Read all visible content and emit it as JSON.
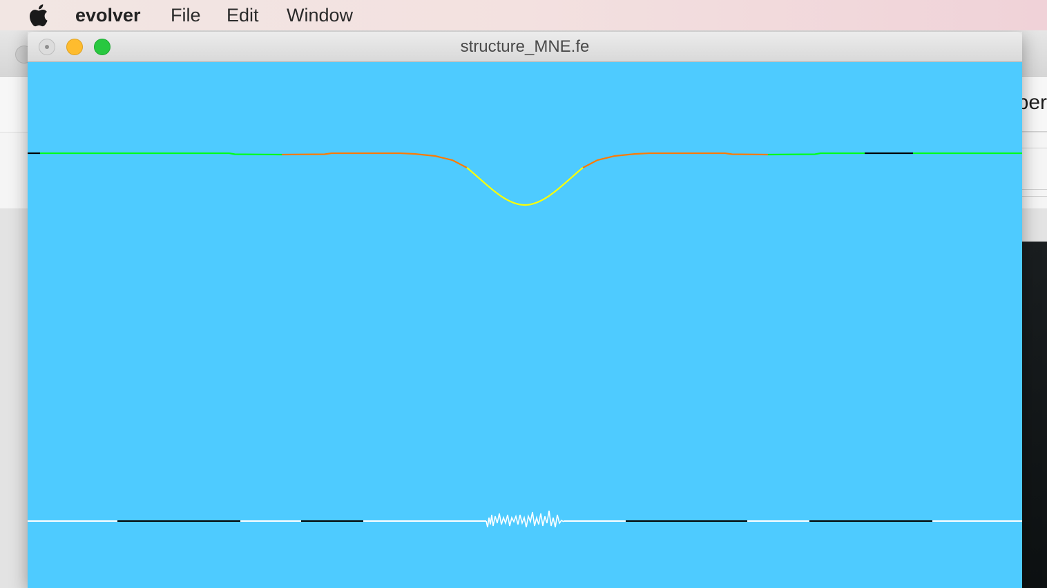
{
  "menubar": {
    "apple_icon": "apple-icon",
    "items": [
      {
        "label": "evolver"
      },
      {
        "label": "File"
      },
      {
        "label": "Edit"
      },
      {
        "label": "Window"
      }
    ]
  },
  "window": {
    "title": "structure_MNE.fe",
    "buttons": [
      "close",
      "minimize",
      "zoom"
    ]
  },
  "canvas": {
    "background_color": "#4ecbff",
    "upper_curve_colors": [
      "#000000",
      "#00ff1a",
      "#ff7a00",
      "#ffff00"
    ],
    "lower_line_colors": [
      "#ffffff",
      "#000000"
    ]
  },
  "background_window": {
    "partial_text": "per"
  }
}
